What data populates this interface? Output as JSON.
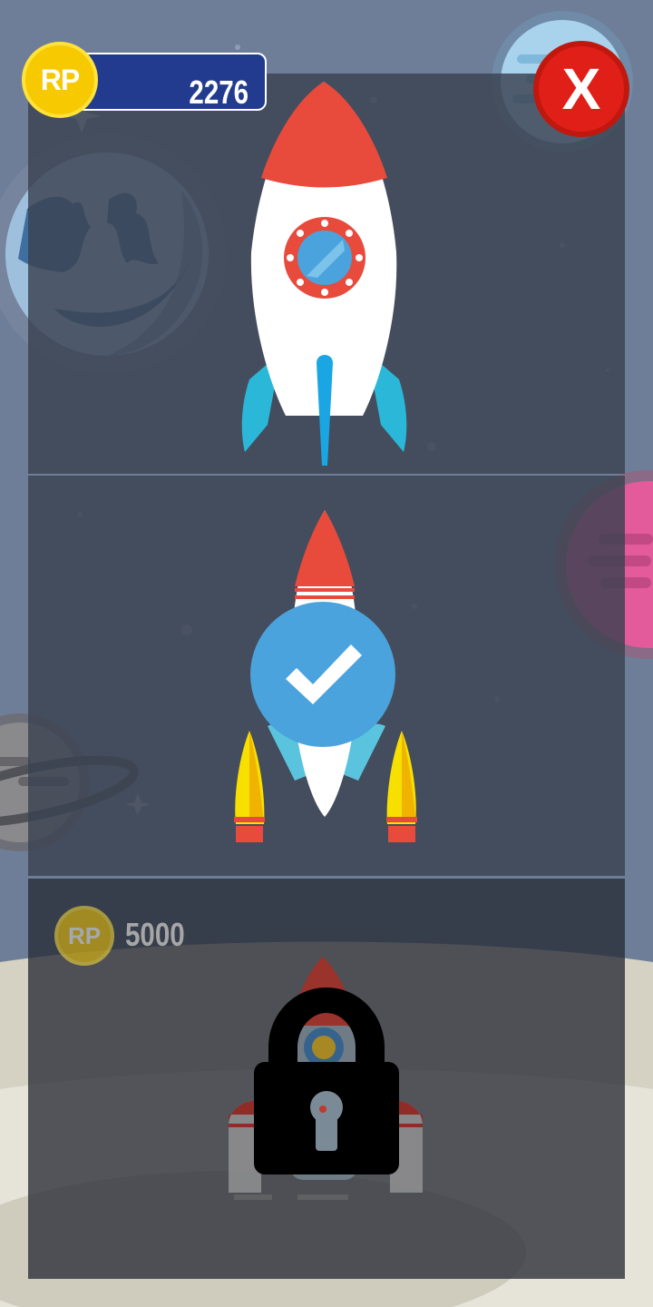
{
  "hud": {
    "currency_symbol": "RP",
    "balance": "2276",
    "close_label": "X"
  },
  "shop": {
    "items": [
      {
        "state": "available"
      },
      {
        "state": "selected"
      },
      {
        "state": "locked",
        "currency_symbol": "RP",
        "price": "5000"
      }
    ]
  },
  "colors": {
    "coin": "#f7c900",
    "balance_bar": "#233b8e",
    "close": "#e02018",
    "selected_badge": "#4aa3dc",
    "rocket_red": "#e84a3c",
    "rocket_blue": "#2bb8d8"
  },
  "icons": [
    "coin-icon",
    "close-icon",
    "checkmark-icon",
    "padlock-icon",
    "rocket-icon",
    "planet-icon"
  ]
}
